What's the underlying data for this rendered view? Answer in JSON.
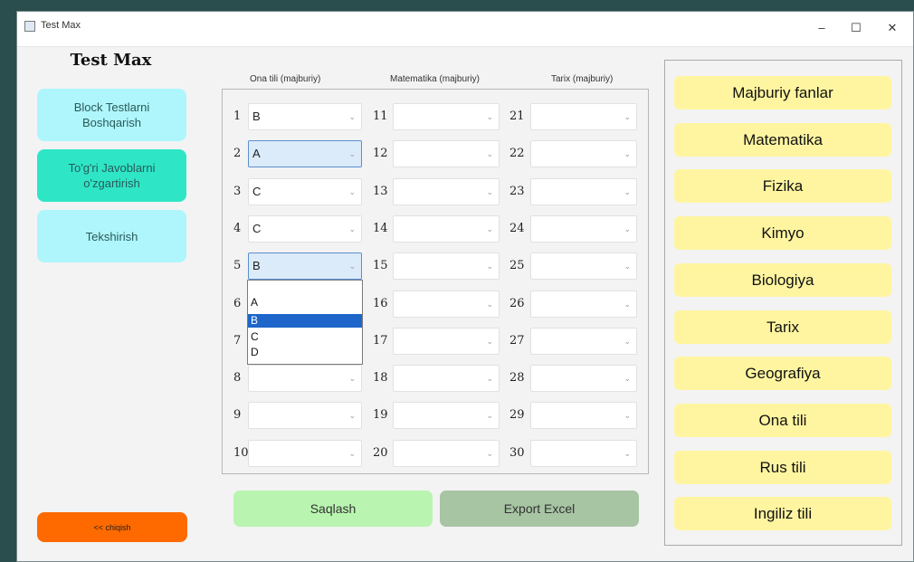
{
  "window": {
    "title": "Test Max",
    "minimize": "–",
    "maximize": "☐",
    "close": "✕"
  },
  "sidebar": {
    "logo": "Test Max",
    "items": [
      {
        "label": "Block Testlarni Boshqarish",
        "color": "#aef6fb"
      },
      {
        "label": "To'g'ri Javoblarni o'zgartirish",
        "color": "#2ee6c6"
      },
      {
        "label": "Tekshirish",
        "color": "#aef6fb"
      }
    ],
    "back_label": "<< chiqish",
    "back_color": "#ff6a00"
  },
  "columns": [
    {
      "header": "Ona tili (majburiy)"
    },
    {
      "header": "Matematika (majburiy)"
    },
    {
      "header": "Tarix (majburiy)"
    }
  ],
  "answers": {
    "col1": [
      {
        "num": "1",
        "value": "B"
      },
      {
        "num": "2",
        "value": "A"
      },
      {
        "num": "3",
        "value": "C"
      },
      {
        "num": "4",
        "value": "C"
      },
      {
        "num": "5",
        "value": "B"
      },
      {
        "num": "6",
        "value": ""
      },
      {
        "num": "7",
        "value": ""
      },
      {
        "num": "8",
        "value": ""
      },
      {
        "num": "9",
        "value": ""
      },
      {
        "num": "10",
        "value": ""
      }
    ],
    "col2": [
      {
        "num": "11",
        "value": ""
      },
      {
        "num": "12",
        "value": ""
      },
      {
        "num": "13",
        "value": ""
      },
      {
        "num": "14",
        "value": ""
      },
      {
        "num": "15",
        "value": ""
      },
      {
        "num": "16",
        "value": ""
      },
      {
        "num": "17",
        "value": ""
      },
      {
        "num": "18",
        "value": ""
      },
      {
        "num": "19",
        "value": ""
      },
      {
        "num": "20",
        "value": ""
      }
    ],
    "col3": [
      {
        "num": "21",
        "value": ""
      },
      {
        "num": "22",
        "value": ""
      },
      {
        "num": "23",
        "value": ""
      },
      {
        "num": "24",
        "value": ""
      },
      {
        "num": "25",
        "value": ""
      },
      {
        "num": "26",
        "value": ""
      },
      {
        "num": "27",
        "value": ""
      },
      {
        "num": "28",
        "value": ""
      },
      {
        "num": "29",
        "value": ""
      },
      {
        "num": "30",
        "value": ""
      }
    ]
  },
  "dropdown": {
    "options": [
      "A",
      "B",
      "C",
      "D"
    ],
    "highlighted": "B"
  },
  "actions": {
    "save_label": "Saqlash",
    "export_label": "Export Excel"
  },
  "subjects": [
    "Majburiy fanlar",
    "Matematika",
    "Fizika",
    "Kimyo",
    "Biologiya",
    "Tarix",
    "Geografiya",
    "Ona tili",
    "Rus tili",
    "Ingiliz tili"
  ],
  "colors": {
    "subject_button": "#fff5a0",
    "save_button": "#b9f5b0",
    "export_button": "#a7c4a3"
  }
}
